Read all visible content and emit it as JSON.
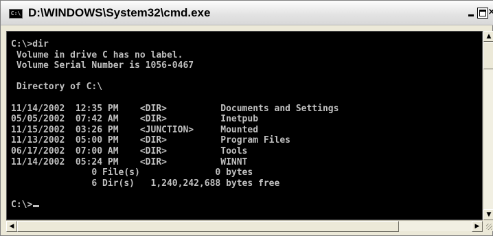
{
  "window": {
    "title": "D:\\WINDOWS\\System32\\cmd.exe",
    "icon": "console-window-icon",
    "icon_glyph": "C:\\",
    "controls": {
      "minimize": "minimize-icon",
      "maximize": "maximize-icon",
      "close_glyph": "×",
      "close": "close-icon"
    }
  },
  "console": {
    "background": "#000000",
    "foreground": "#c0c0c0",
    "lines": [
      "C:\\>dir",
      " Volume in drive C has no label.",
      " Volume Serial Number is 1056-0467",
      "",
      " Directory of C:\\",
      "",
      "11/14/2002  12:35 PM    <DIR>          Documents and Settings",
      "05/05/2002  07:42 AM    <DIR>          Inetpub",
      "11/15/2002  03:26 PM    <JUNCTION>     Mounted",
      "11/13/2002  05:00 PM    <DIR>          Program Files",
      "06/17/2002  07:00 AM    <DIR>          Tools",
      "11/14/2002  05:24 PM    <DIR>          WINNT",
      "               0 File(s)              0 bytes",
      "               6 Dir(s)   1,240,242,688 bytes free",
      ""
    ],
    "prompt": "C:\\>"
  },
  "scrollbars": {
    "up_glyph": "▲",
    "down_glyph": "▼",
    "left_glyph": "◀",
    "right_glyph": "▶"
  }
}
